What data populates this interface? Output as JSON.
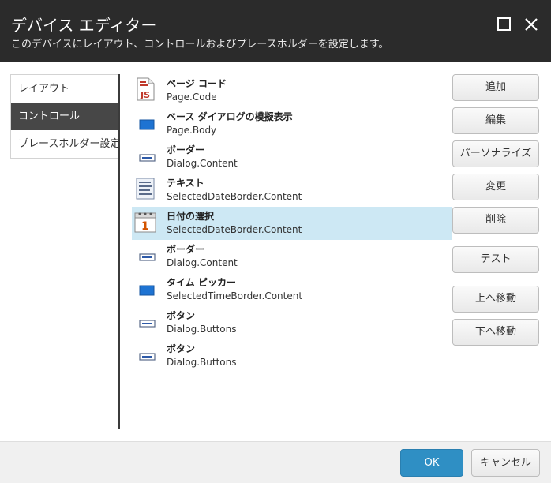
{
  "dialog": {
    "title": "デバイス エディター",
    "subtitle": "このデバイスにレイアウト、コントロールおよびプレースホルダーを設定します。"
  },
  "nav": {
    "items": [
      {
        "label": "レイアウト"
      },
      {
        "label": "コントロール"
      },
      {
        "label": "プレースホルダー設定"
      }
    ],
    "active": "コントロール"
  },
  "controls": [
    {
      "name": "ページ コード",
      "path": "Page.Code",
      "icon": "js-file-icon"
    },
    {
      "name": "ベース ダイアログの模擬表示",
      "path": "Page.Body",
      "icon": "blue-rectangle-icon"
    },
    {
      "name": "ボーダー",
      "path": "Dialog.Content",
      "icon": "border-icon"
    },
    {
      "name": "テキスト",
      "path": "SelectedDateBorder.Content",
      "icon": "text-document-icon"
    },
    {
      "name": "日付の選択",
      "path": "SelectedDateBorder.Content",
      "icon": "calendar-icon"
    },
    {
      "name": "ボーダー",
      "path": "Dialog.Content",
      "icon": "border-icon"
    },
    {
      "name": "タイム ピッカー",
      "path": "SelectedTimeBorder.Content",
      "icon": "blue-rectangle-icon"
    },
    {
      "name": "ボタン",
      "path": "Dialog.Buttons",
      "icon": "button-icon"
    },
    {
      "name": "ボタン",
      "path": "Dialog.Buttons",
      "icon": "button-icon"
    }
  ],
  "selected_control": "日付の選択",
  "actions": {
    "add": "追加",
    "edit": "編集",
    "personalize": "パーソナライズ",
    "change": "変更",
    "delete": "削除",
    "test": "テスト",
    "move_up": "上へ移動",
    "move_down": "下へ移動"
  },
  "footer": {
    "ok": "OK",
    "cancel": "キャンセル"
  },
  "colors": {
    "header_bg": "#2b2b2b",
    "nav_active_bg": "#474747",
    "selection_bg": "#cde8f4",
    "primary_button": "#2f8fc4"
  }
}
